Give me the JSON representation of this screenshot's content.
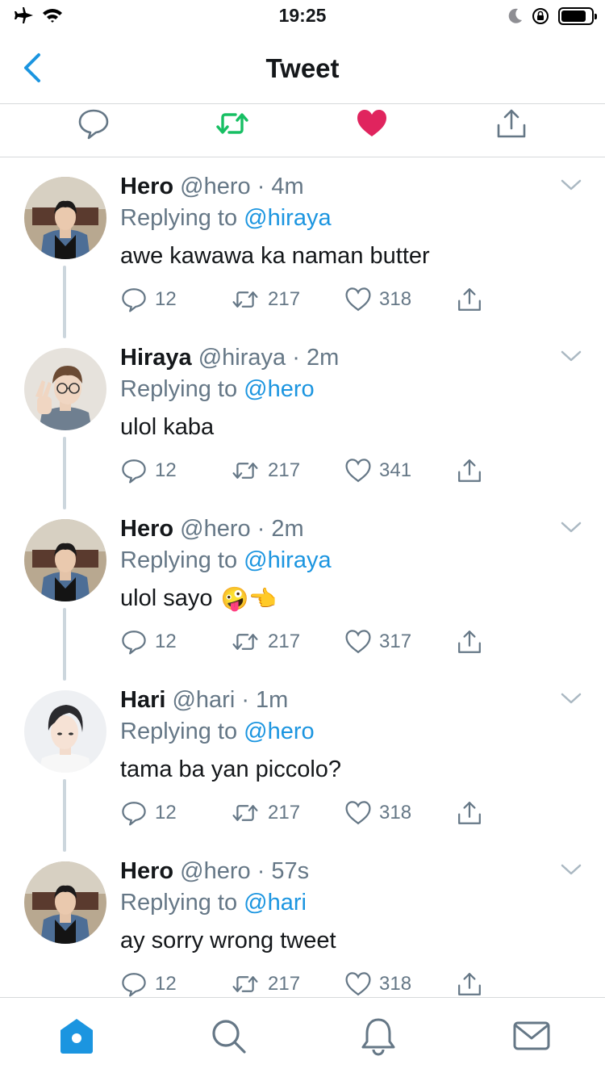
{
  "status_bar": {
    "time": "19:25"
  },
  "nav": {
    "title": "Tweet"
  },
  "colors": {
    "accent": "#1b95e0",
    "retweet_green": "#17bf63",
    "like_red": "#e0245e",
    "muted": "#657786"
  },
  "main_tweet_actions": {
    "icons": [
      "reply-icon",
      "retweet-icon",
      "like-icon",
      "share-icon"
    ],
    "retweeted": true,
    "liked": true
  },
  "replies": [
    {
      "name": "Hero",
      "handle": "@hero",
      "time": "· 4m",
      "replying_prefix": "Replying to",
      "replying_to": "@hiraya",
      "text": "awe kawawa ka naman butter",
      "emoji": "",
      "replies": "12",
      "retweets": "217",
      "likes": "318"
    },
    {
      "name": "Hiraya",
      "handle": "@hiraya",
      "time": "· 2m",
      "replying_prefix": "Replying to",
      "replying_to": "@hero",
      "text": "ulol kaba",
      "emoji": "",
      "replies": "12",
      "retweets": "217",
      "likes": "341"
    },
    {
      "name": "Hero",
      "handle": "@hero",
      "time": "· 2m",
      "replying_prefix": "Replying to",
      "replying_to": "@hiraya",
      "text": "ulol sayo",
      "emoji": "🤪👈",
      "replies": "12",
      "retweets": "217",
      "likes": "317"
    },
    {
      "name": "Hari",
      "handle": "@hari",
      "time": "· 1m",
      "replying_prefix": "Replying to",
      "replying_to": "@hero",
      "text": "tama ba yan piccolo?",
      "emoji": "",
      "replies": "12",
      "retweets": "217",
      "likes": "318"
    },
    {
      "name": "Hero",
      "handle": "@hero",
      "time": "· 57s",
      "replying_prefix": "Replying to",
      "replying_to": "@hari",
      "text": "ay sorry wrong tweet",
      "emoji": "",
      "replies": "12",
      "retweets": "217",
      "likes": "318"
    }
  ],
  "tab_bar": {
    "tabs": [
      "home-icon",
      "search-icon",
      "notifications-icon",
      "messages-icon"
    ],
    "active": "home-icon"
  }
}
